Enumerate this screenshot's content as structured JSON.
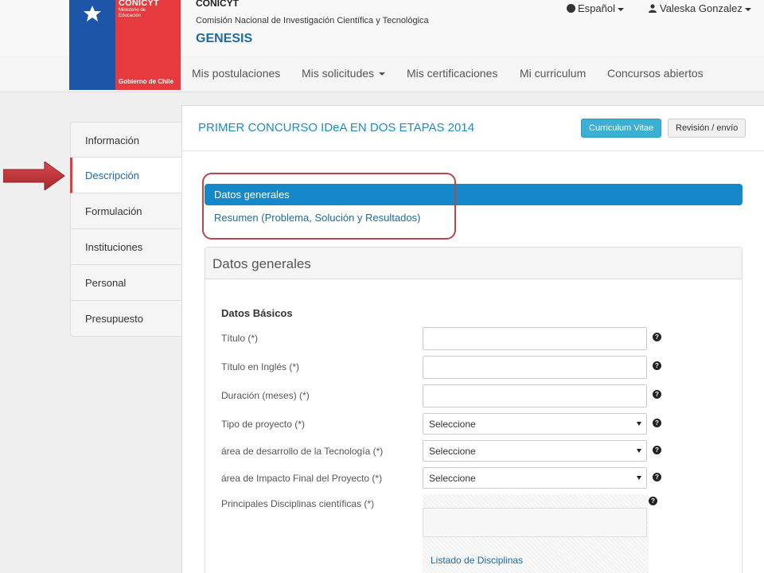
{
  "header": {
    "logo": {
      "org": "CONICYT",
      "ministry": "Ministerio de Educación",
      "government": "Gobierno de Chile"
    },
    "org_name": "CONICYT",
    "org_full_name": "Comisión Nacional de Investigación Científica y Tecnológica",
    "app_name": "GENESIS",
    "language_label": "Español",
    "user_name": "Valeska Gonzalez"
  },
  "nav": {
    "items": [
      "Mis postulaciones",
      "Mis solicitudes",
      "Mis certificaciones",
      "Mi curriculum",
      "Concursos abiertos"
    ]
  },
  "sidebar": {
    "items": [
      "Información",
      "Descripción",
      "Formulación",
      "Instituciones",
      "Personal",
      "Presupuesto"
    ],
    "active": "Descripción"
  },
  "panel": {
    "title": "PRIMER CONCURSO IDeA EN DOS ETAPAS 2014",
    "buttons": {
      "cv": "Curriculum Vitae",
      "review": "Revisión / envío"
    }
  },
  "subnav": {
    "active": "Datos generales",
    "link": "Resumen (Problema, Solución y Resultados)"
  },
  "form": {
    "heading": "Datos generales",
    "section_title": "Datos Básicos",
    "fields": {
      "titulo": "Título (*)",
      "titulo_en": "Título en Inglés (*)",
      "duracion": "Duración (meses) (*)",
      "tipo": "Tipo de proyecto (*)",
      "area_tecnologia": "área de desarrollo de la Tecnología (*)",
      "area_impacto": "área de Impacto Final del Proyecto (*)",
      "disciplinas": "Principales Disciplinas científicas (*)"
    },
    "select_default": "Seleccione",
    "disciplinas_link": "Listado de Disciplinas",
    "help_glyph": "?"
  },
  "colors": {
    "accent_blue": "#1488c8",
    "brand_red": "#e63a3f",
    "brand_blue": "#1d56a8",
    "highlight_box": "#b5474e"
  }
}
